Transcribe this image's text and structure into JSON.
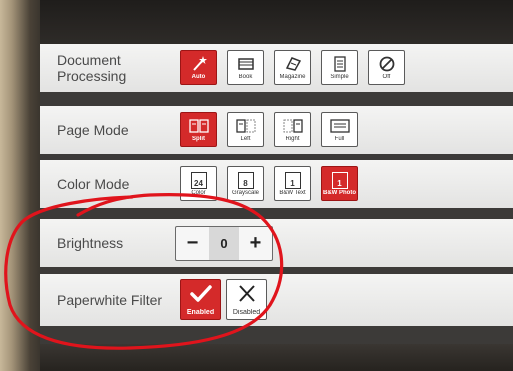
{
  "settings": {
    "document_processing": {
      "label": "Document\nProcessing",
      "options": [
        {
          "label": "Auto",
          "icon": "magic-wand-icon",
          "selected": true
        },
        {
          "label": "Book",
          "icon": "book-icon",
          "selected": false
        },
        {
          "label": "Magazine",
          "icon": "magazine-icon",
          "selected": false
        },
        {
          "label": "Simple",
          "icon": "page-icon",
          "selected": false
        },
        {
          "label": "Off",
          "icon": "no-symbol-icon",
          "selected": false
        }
      ]
    },
    "page_mode": {
      "label": "Page Mode",
      "options": [
        {
          "label": "Split",
          "icon": "split-page-icon",
          "selected": true
        },
        {
          "label": "Left",
          "icon": "left-page-icon",
          "selected": false
        },
        {
          "label": "Right",
          "icon": "right-page-icon",
          "selected": false
        },
        {
          "label": "Full",
          "icon": "full-page-icon",
          "selected": false
        }
      ]
    },
    "color_mode": {
      "label": "Color Mode",
      "options": [
        {
          "label": "Color",
          "icon": "color-24bit-icon",
          "icon_text": "24",
          "selected": false
        },
        {
          "label": "Grayscale",
          "icon": "grayscale-8bit-icon",
          "icon_text": "8",
          "selected": false
        },
        {
          "label": "B&W Text",
          "icon": "bw-text-1bit-icon",
          "icon_text": "1",
          "selected": false
        },
        {
          "label": "B&W Photo",
          "icon": "bw-photo-1bit-icon",
          "icon_text": "1",
          "selected": true
        }
      ]
    },
    "brightness": {
      "label": "Brightness",
      "minus": "−",
      "value": "0",
      "plus": "+"
    },
    "paperwhite_filter": {
      "label": "Paperwhite Filter",
      "options": [
        {
          "label": "Enabled",
          "icon": "checkmark-icon",
          "selected": true
        },
        {
          "label": "Disabled",
          "icon": "x-icon",
          "selected": false
        }
      ]
    }
  },
  "colors": {
    "selected": "#d42a2a",
    "annotation": "#e0141c",
    "row_bg": "#efefee",
    "separator": "#3c3a38"
  }
}
